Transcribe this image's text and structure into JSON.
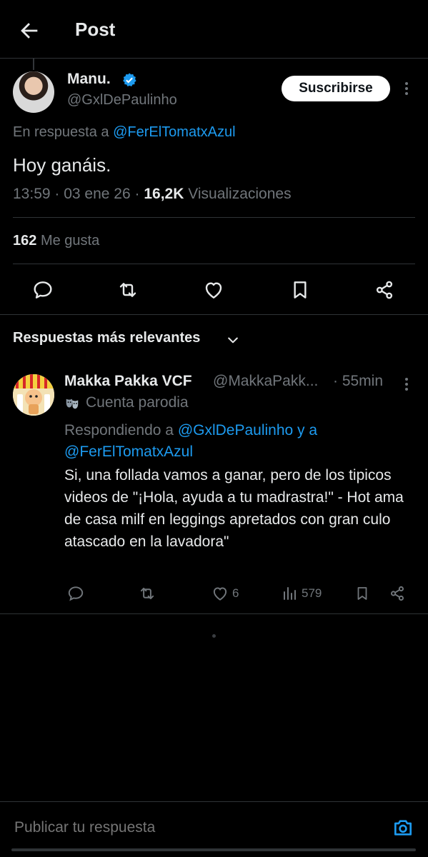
{
  "header": {
    "title": "Post"
  },
  "post": {
    "author_name": "Manu.",
    "author_handle": "@GxlDePaulinho",
    "subscribe_label": "Suscribirse",
    "reply_prefix": "En respuesta a",
    "reply_to": "@FerElTomatxAzul",
    "text": "Hoy ganáis.",
    "time": "13:59",
    "date": "03 ene 26",
    "views_count": "16,2K",
    "views_label": "Visualizaciones",
    "likes_count": "162",
    "likes_label": "Me gusta"
  },
  "replies_sort": {
    "label": "Respuestas más relevantes"
  },
  "reply": {
    "name": "Makka Pakka VCF",
    "handle": "@MakkaPakk...",
    "time": "· 55min",
    "parody_label": "Cuenta parodia",
    "replying_prefix": "Respondiendo a",
    "replying_to_1": "@GxlDePaulinho y a",
    "replying_to_2": "@FerElTomatxAzul",
    "text": "Si, una follada vamos a ganar, pero de los tipicos videos de \"¡Hola, ayuda a tu madrastra!\" - Hot ama de casa milf en leggings apretados con gran culo atascado en la lavadora\"",
    "likes": "6",
    "views": "579"
  },
  "composer": {
    "placeholder": "Publicar tu respuesta"
  },
  "colors": {
    "accent": "#1d9bf0",
    "muted": "#71767b",
    "divider": "#2f3336"
  }
}
